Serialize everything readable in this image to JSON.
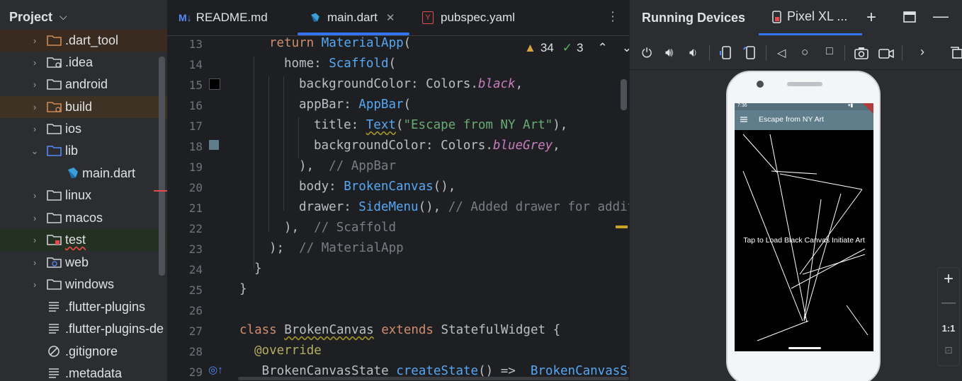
{
  "project": {
    "title": "Project",
    "items": [
      {
        "label": ".dart_tool",
        "expandable": true
      },
      {
        "label": ".idea",
        "expandable": true
      },
      {
        "label": "android",
        "expandable": true
      },
      {
        "label": "build",
        "expandable": true
      },
      {
        "label": "ios",
        "expandable": true
      },
      {
        "label": "lib",
        "expandable": true,
        "expanded": true
      },
      {
        "label": "main.dart",
        "expandable": false
      },
      {
        "label": "linux",
        "expandable": true
      },
      {
        "label": "macos",
        "expandable": true
      },
      {
        "label": "test",
        "expandable": true
      },
      {
        "label": "web",
        "expandable": true
      },
      {
        "label": "windows",
        "expandable": true
      },
      {
        "label": ".flutter-plugins",
        "expandable": false
      },
      {
        "label": ".flutter-plugins-de",
        "expandable": false
      },
      {
        "label": ".gitignore",
        "expandable": false
      },
      {
        "label": ".metadata",
        "expandable": false
      }
    ]
  },
  "editor": {
    "tabs": [
      {
        "label": "README.md",
        "icon": "markdown-icon"
      },
      {
        "label": "main.dart",
        "icon": "dart-icon",
        "active": true
      },
      {
        "label": "pubspec.yaml",
        "icon": "yaml-icon"
      }
    ],
    "inspections": {
      "warnings": "34",
      "typos": "3"
    },
    "line_numbers": [
      "13",
      "14",
      "15",
      "16",
      "17",
      "18",
      "19",
      "20",
      "21",
      "22",
      "23",
      "24",
      "25",
      "26",
      "27",
      "28",
      "29"
    ],
    "code": {
      "l13_a": "return",
      "l13_b": "MaterialApp",
      "l14_a": "home: ",
      "l14_b": "Scaffold",
      "l15_a": "backgroundColor: Colors.",
      "l15_b": "black",
      "l16_a": "appBar: ",
      "l16_b": "AppBar",
      "l17_a": "title: ",
      "l17_b": "Text",
      "l17_c": "\"Escape from NY Art\"",
      "l18_a": "backgroundColor: Colors.",
      "l18_b": "blueGrey",
      "l19_a": "),  ",
      "l19_b": "// AppBar",
      "l20_a": "body: ",
      "l20_b": "BrokenCanvas",
      "l21_a": "drawer: ",
      "l21_b": "SideMenu",
      "l21_c": "// Added drawer for addit",
      "l22_a": "),  ",
      "l22_b": "// Scaffold",
      "l23_a": ");  ",
      "l23_b": "// MaterialApp",
      "l24": "}",
      "l25": "}",
      "l27_a": "class",
      "l27_b": "BrokenCanvas",
      "l27_c": "extends",
      "l27_d": "StatefulWidget {",
      "l28": "@override",
      "l29_a": "_BrokenCanvasState ",
      "l29_b": "createState",
      "l29_c": "_BrokenCanvasSt"
    }
  },
  "devices": {
    "title": "Running Devices",
    "device_tab": "Pixel XL ...",
    "zoom_actual": "1:1",
    "app": {
      "title": "Escape from NY Art",
      "status_time": "7:36",
      "tap_text": "Tap to Load Black Canvas Initiate Art"
    }
  },
  "colors": {
    "accent": "#3574f0",
    "app_bar": "#607d8b",
    "swatch_black": "#000000",
    "swatch_bluegrey": "#607d8b"
  }
}
